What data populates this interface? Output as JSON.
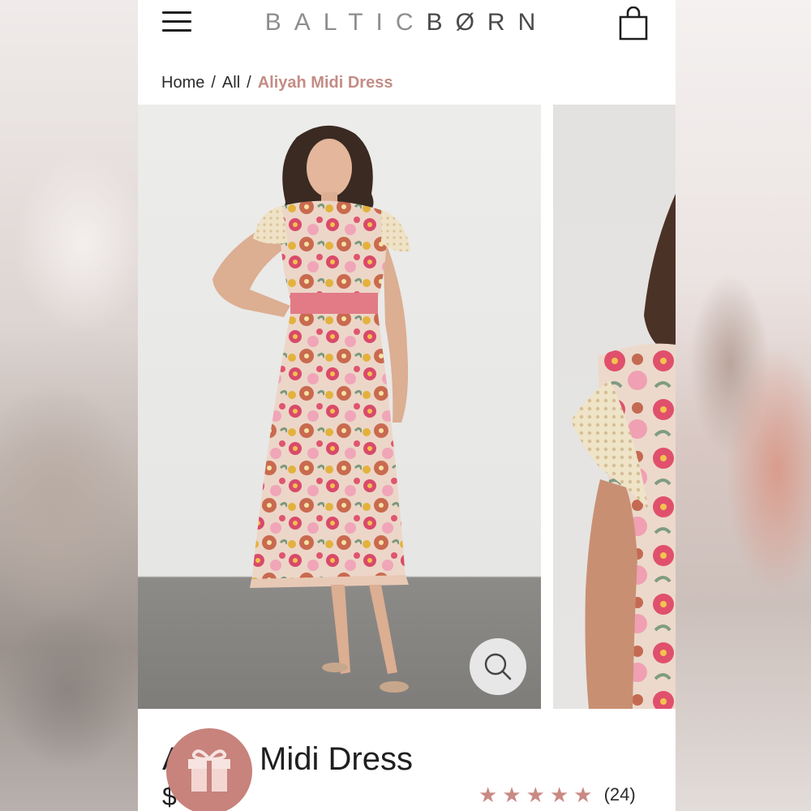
{
  "brand": {
    "part1": "BALTIC",
    "part2": "BØRN"
  },
  "header": {
    "menu_icon": "hamburger-menu-icon",
    "cart_icon": "shopping-bag-icon"
  },
  "breadcrumb": {
    "home": "Home",
    "separator": "/",
    "all": "All",
    "current": "Aliyah Midi Dress"
  },
  "gallery": {
    "zoom_icon": "search-icon"
  },
  "product": {
    "title": "Aliyah Midi Dress",
    "price": "$",
    "rating_stars": 5,
    "review_count": "(24)"
  },
  "gift": {
    "icon": "gift-icon"
  },
  "colors": {
    "accent": "#c38d86",
    "star": "#c98a84",
    "gift_button": "#c7837c",
    "text": "#1f1f1f"
  }
}
